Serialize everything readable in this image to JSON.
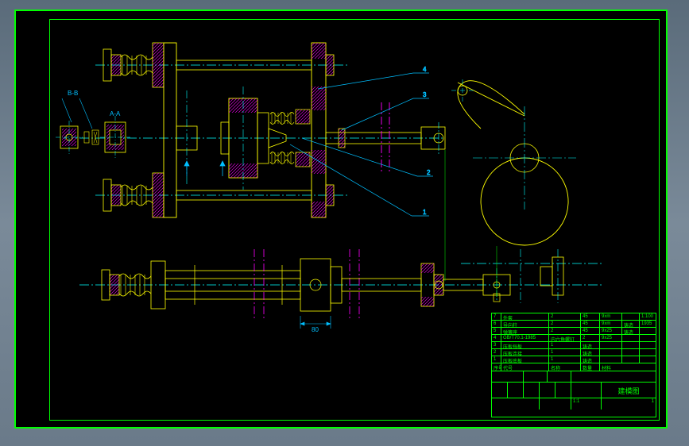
{
  "drawing": {
    "title": "建模图",
    "sheet": "1",
    "scale": "1:1",
    "callouts": [
      "1",
      "2",
      "3",
      "4"
    ],
    "section_labels": [
      "A-A",
      "B-B"
    ],
    "dimension_mark": "80"
  },
  "parts_list": {
    "rows": [
      {
        "no": "7",
        "name": "外套",
        "qty": "2",
        "material": "45"
      },
      {
        "no": "6",
        "name": "导向柱",
        "qty": "2",
        "material": "45"
      },
      {
        "no": "5",
        "name": "弹簧座",
        "qty": "2",
        "material": "45"
      },
      {
        "no": "4",
        "name": "GB/T70.1-1985",
        "qty": "内六角螺钉",
        "material": "2"
      },
      {
        "no": "3",
        "name": "压板挡板",
        "qty": "1",
        "material": "铸造"
      },
      {
        "no": "2",
        "name": "压板连接",
        "qty": "1",
        "material": "铸造"
      },
      {
        "no": "1",
        "name": "压板底板",
        "qty": "1",
        "material": "铸造"
      }
    ],
    "headers": [
      "序号",
      "代号",
      "名称",
      "数量",
      "材料"
    ],
    "right_cols": [
      {
        "a": "9xm",
        "b": "",
        "c": "1:100"
      },
      {
        "a": "9xm",
        "b": "铸造",
        "c": "1935"
      },
      {
        "a": "9x25",
        "b": "铸造",
        "c": ""
      },
      {
        "a": "9x25",
        "b": "",
        "c": ""
      }
    ]
  },
  "colors": {
    "outline": "#00ff00",
    "detail": "#ffff00",
    "centerline": "#00ffff",
    "hatch": "#ff00ff",
    "leader": "#00bfff"
  }
}
